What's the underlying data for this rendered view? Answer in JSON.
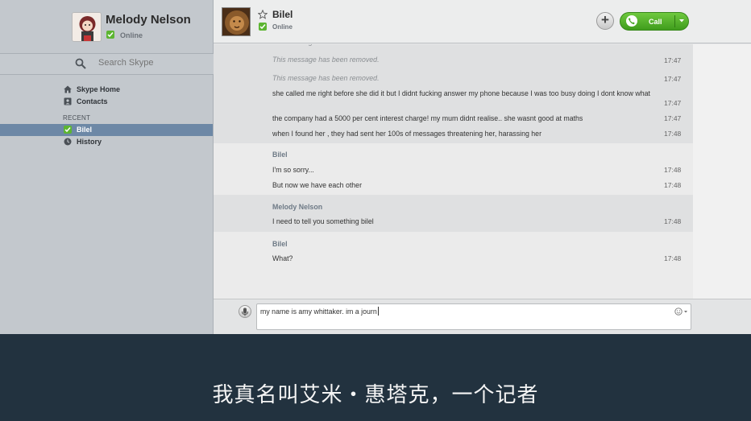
{
  "profile": {
    "name": "Melody Nelson",
    "status": "Online"
  },
  "search": {
    "placeholder": "Search Skype"
  },
  "nav": {
    "home": "Skype Home",
    "contacts": "Contacts"
  },
  "recent": {
    "header": "RECENT",
    "items": [
      {
        "label": "Bilel",
        "selected": true
      }
    ]
  },
  "history": {
    "label": "History"
  },
  "contact": {
    "name": "Bilel",
    "status": "Online"
  },
  "toolbar": {
    "call_label": "Call"
  },
  "chat": {
    "messages": [
      {
        "text": "This message has been removed.",
        "time": "17:47"
      },
      {
        "text": "This message has been removed.",
        "time": "17:47"
      },
      {
        "text": "she called me right before she did it but I didnt fucking answer my phone because I was too busy doing I dont know what",
        "time": "17:47"
      },
      {
        "text": "the company had a 5000 per cent interest charge! my mum didnt realise.. she wasnt good at maths",
        "time": "17:47"
      },
      {
        "text": "when I found her , they had sent her 100s of messages threatening her, harassing her",
        "time": "17:48"
      }
    ],
    "groups": [
      {
        "sender": "Bilel",
        "messages": [
          {
            "text": "I'm so sorry...",
            "time": "17:48"
          },
          {
            "text": "But now we have each other",
            "time": "17:48"
          }
        ]
      },
      {
        "sender": "Melody Nelson",
        "messages": [
          {
            "text": "I need to tell you something bilel",
            "time": "17:48"
          }
        ]
      },
      {
        "sender": "Bilel",
        "messages": [
          {
            "text": "What?",
            "time": "17:48"
          }
        ]
      }
    ]
  },
  "compose": {
    "text": "my name is amy whittaker. im a journ"
  },
  "subtitle": {
    "text": "我真名叫艾米・惠塔克，一个记者"
  },
  "colors": {
    "accent_green": "#5cb531",
    "selection_blue": "#6d88a6",
    "subtitle_bg": "#22323f"
  }
}
